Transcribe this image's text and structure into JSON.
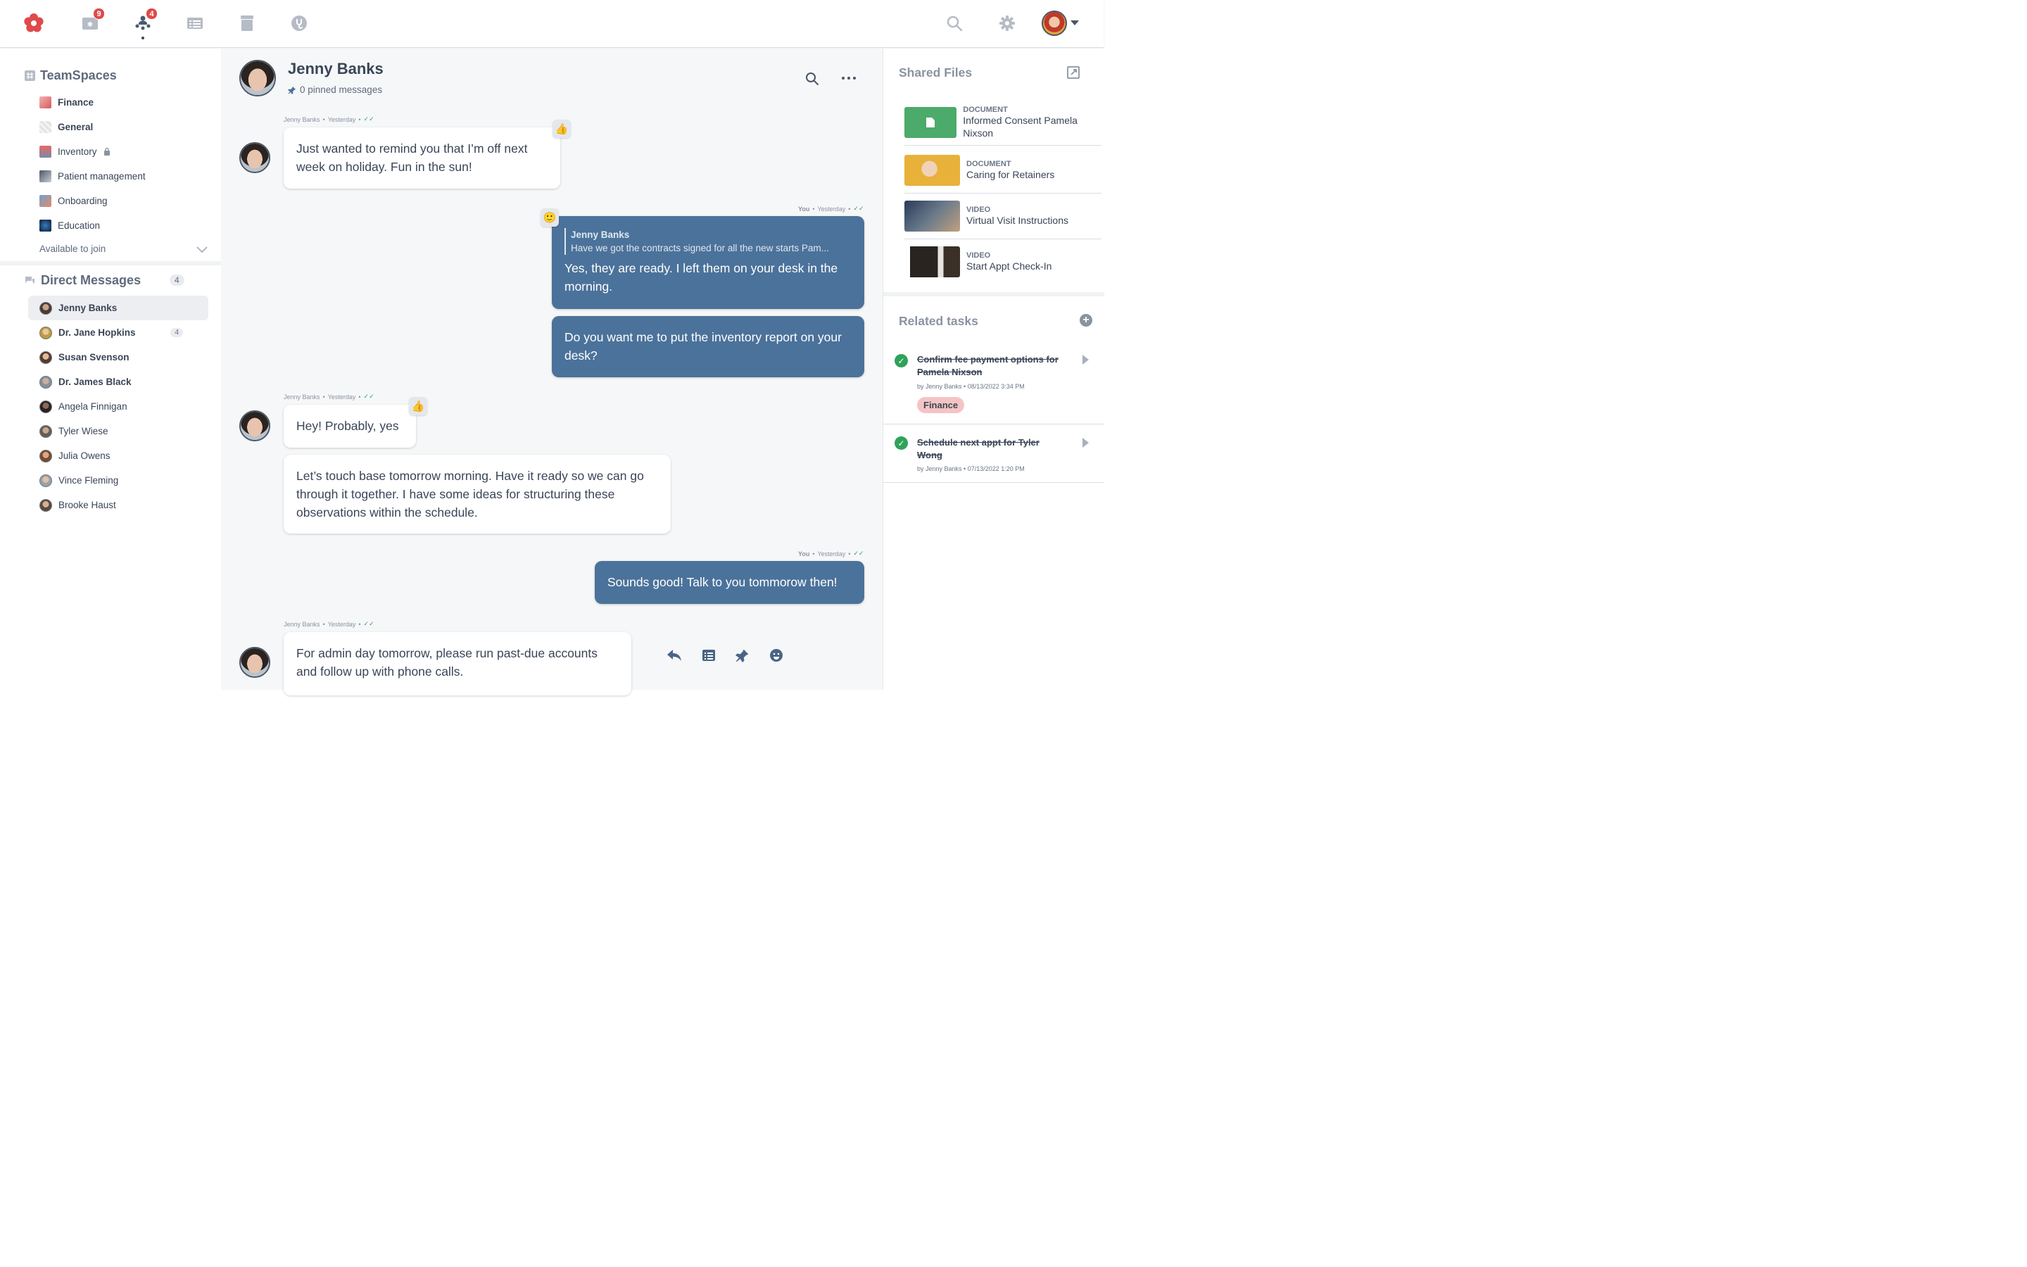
{
  "topnav": {
    "badge_messages": "9",
    "badge_team": "4"
  },
  "sidebar": {
    "teamspaces_title": "TeamSpaces",
    "teamspaces": [
      {
        "label": "Finance"
      },
      {
        "label": "General"
      },
      {
        "label": "Inventory"
      },
      {
        "label": "Patient management"
      },
      {
        "label": "Onboarding"
      },
      {
        "label": "Education"
      }
    ],
    "available_label": "Available to join",
    "dm_title": "Direct Messages",
    "dm_count": "4",
    "dms": [
      {
        "label": "Jenny Banks"
      },
      {
        "label": "Dr. Jane Hopkins",
        "count": "4"
      },
      {
        "label": "Susan Svenson"
      },
      {
        "label": "Dr. James Black"
      },
      {
        "label": "Angela Finnigan"
      },
      {
        "label": "Tyler Wiese"
      },
      {
        "label": "Julia Owens"
      },
      {
        "label": "Vince Fleming"
      },
      {
        "label": "Brooke Haust"
      }
    ]
  },
  "chat": {
    "name": "Jenny Banks",
    "pinned": "0 pinned messages",
    "messages": [
      {
        "meta_name": "Jenny Banks",
        "meta_time": "Yesterday",
        "text": "Just wanted to remind you that I’m off next week on holiday. Fun in the sun!"
      },
      {
        "meta_name": "You",
        "meta_time": "Yesterday",
        "quote_name": "Jenny Banks",
        "quote_text": "Have we got the contracts signed for all the new starts Pam...",
        "text": "Yes, they are ready. I left them on your desk in the morning."
      },
      {
        "text": "Do you want me to put the inventory report on your desk?"
      },
      {
        "meta_name": "Jenny Banks",
        "meta_time": "Yesterday",
        "text": "Hey! Probably, yes"
      },
      {
        "text": "Let’s touch base tomorrow morning. Have it ready so we can go through it together. I have some ideas for structuring these observations within the schedule."
      },
      {
        "meta_name": "You",
        "meta_time": "Yesterday",
        "text": "Sounds good! Talk to you tommorow then!"
      },
      {
        "meta_name": "Jenny Banks",
        "meta_time": "Yesterday",
        "text": "For admin day tomorrow, please run past-due accounts and follow up with phone calls."
      }
    ]
  },
  "right": {
    "files_title": "Shared Files",
    "files": [
      {
        "type": "Document",
        "name": "Informed Consent Pamela Nixson"
      },
      {
        "type": "Document",
        "name": "Caring for Retainers"
      },
      {
        "type": "Video",
        "name": "Virtual Visit Instructions"
      },
      {
        "type": "Video",
        "name": "Start Appt Check-In"
      }
    ],
    "tasks_title": "Related tasks",
    "tasks": [
      {
        "title": "Confirm fee payment options for Pamela Nixson",
        "meta": "by Jenny Banks • 08/13/2022 3:34 PM",
        "tag": "Finance"
      },
      {
        "title": "Schedule next appt for Tyler Wong",
        "meta": "by Jenny Banks • 07/13/2022 1:20 PM"
      }
    ]
  },
  "icons": {
    "logo": "flower-logo-icon",
    "nav": [
      "messages-icon",
      "team-chat-icon",
      "list-icon",
      "archive-icon",
      "stethoscope-icon"
    ],
    "header": [
      "search-icon",
      "settings-icon",
      "user-avatar"
    ]
  },
  "colors": {
    "brand": "#e04a4a",
    "outgoing_bubble": "#4b729a",
    "success": "#2fa25a",
    "tag_finance": "#f4c4c4"
  }
}
